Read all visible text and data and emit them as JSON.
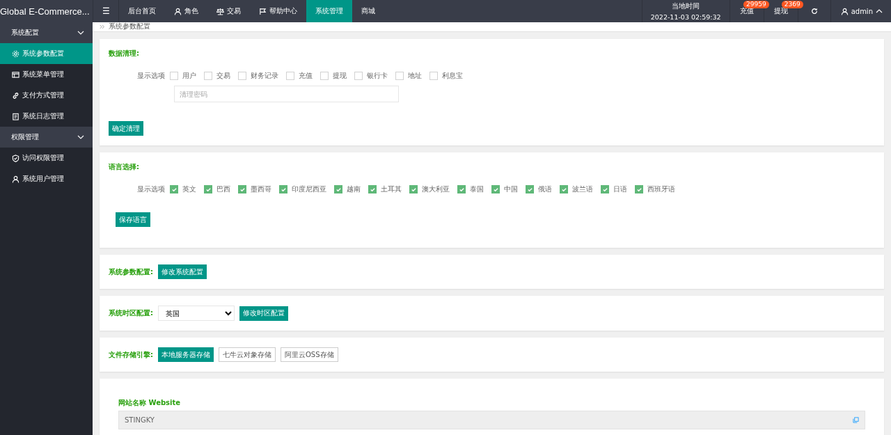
{
  "header": {
    "brand": "Global E-Commerce...",
    "menu_icon": "☰",
    "nav": [
      {
        "label": "后台首页",
        "selected": false
      },
      {
        "label": "角色",
        "selected": false
      },
      {
        "label": "交易",
        "selected": false
      },
      {
        "label": "帮助中心",
        "selected": false
      },
      {
        "label": "系统管理",
        "selected": true
      },
      {
        "label": "商城",
        "selected": false
      }
    ],
    "clock": {
      "label": "当地时间",
      "time": "2022-11-03 02:59:32"
    },
    "actions": [
      {
        "label": "充值",
        "badge": "29959"
      },
      {
        "label": "提现",
        "badge": "2369"
      }
    ],
    "user": "admin"
  },
  "sidebar": [
    {
      "label": "系统配置",
      "expanded": true,
      "children": [
        {
          "label": "系统参数配置",
          "selected": true
        },
        {
          "label": "系统菜单管理",
          "selected": false
        },
        {
          "label": "支付方式管理",
          "selected": false
        },
        {
          "label": "系统日志管理",
          "selected": false
        }
      ]
    },
    {
      "label": "权限管理",
      "expanded": true,
      "children": [
        {
          "label": "访问权限管理",
          "selected": false
        },
        {
          "label": "系统用户管理",
          "selected": false
        }
      ]
    }
  ],
  "breadcrumb": "系统参数配置",
  "data_clear": {
    "title": "数据清理:",
    "options_label": "显示选项",
    "options": [
      {
        "label": "用户",
        "checked": false
      },
      {
        "label": "交易",
        "checked": false
      },
      {
        "label": "财务记录",
        "checked": false
      },
      {
        "label": "充值",
        "checked": false
      },
      {
        "label": "提现",
        "checked": false
      },
      {
        "label": "银行卡",
        "checked": false
      },
      {
        "label": "地址",
        "checked": false
      },
      {
        "label": "利息宝",
        "checked": false
      }
    ],
    "password": {
      "placeholder": "清理密码"
    },
    "button": "确定清理"
  },
  "languages": {
    "title": "语言选择:",
    "options_label": "显示选项",
    "options": [
      {
        "label": "英文",
        "checked": true
      },
      {
        "label": "巴西",
        "checked": true
      },
      {
        "label": "墨西哥",
        "checked": true
      },
      {
        "label": "印度尼西亚",
        "checked": true
      },
      {
        "label": "越南",
        "checked": true
      },
      {
        "label": "土耳其",
        "checked": true
      },
      {
        "label": "澳大利亚",
        "checked": true
      },
      {
        "label": "泰国",
        "checked": true
      },
      {
        "label": "中国",
        "checked": true
      },
      {
        "label": "俄语",
        "checked": true
      },
      {
        "label": "波兰语",
        "checked": true
      },
      {
        "label": "日语",
        "checked": true
      },
      {
        "label": "西班牙语",
        "checked": true
      }
    ],
    "button": "保存语言"
  },
  "system_params": {
    "title": "系统参数配置:",
    "button": "修改系统配置"
  },
  "timezone": {
    "title": "系统时区配置:",
    "value": "英国",
    "button": "修改时区配置"
  },
  "storage": {
    "title": "文件存储引擎:",
    "options": [
      {
        "label": "本地服务器存储",
        "selected": true
      },
      {
        "label": "七牛云对象存储",
        "selected": false
      },
      {
        "label": "阿里云OSS存储",
        "selected": false
      }
    ]
  },
  "website": {
    "label": "网站名称 Website",
    "value": "STINGKY"
  }
}
